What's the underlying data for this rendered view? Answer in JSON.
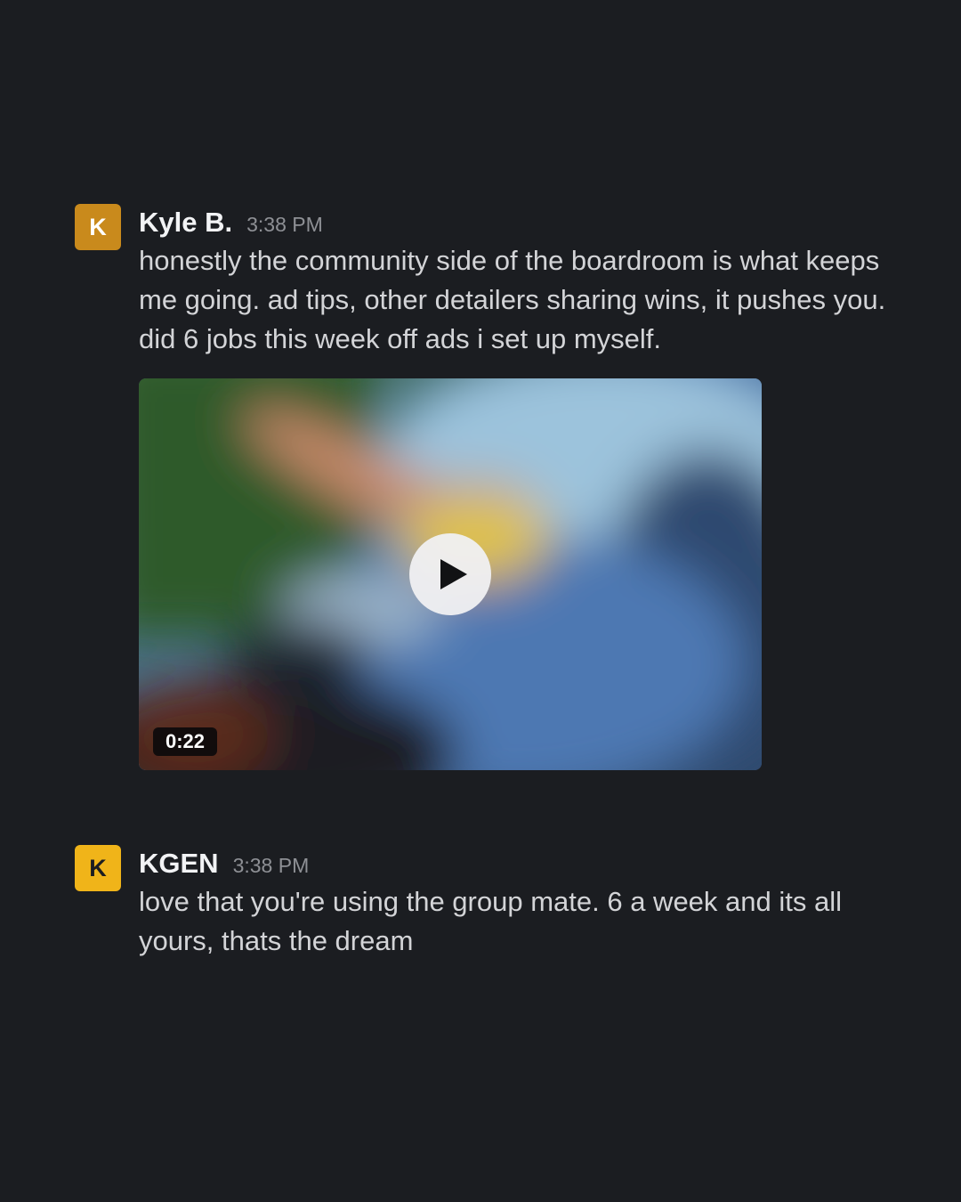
{
  "messages": [
    {
      "avatar_letter": "K",
      "avatar_color": "#c98a1c",
      "author": "Kyle B.",
      "time": "3:38 PM",
      "text": "honestly the community side of the boardroom is what keeps me going. ad tips, other detailers sharing wins, it pushes you. did 6 jobs this week off ads i set up myself.",
      "attachment": {
        "type": "video",
        "duration": "0:22",
        "play_icon": "play-icon"
      }
    },
    {
      "avatar_letter": "K",
      "avatar_color": "#f0b419",
      "author": "KGEN",
      "time": "3:38 PM",
      "text": "love that you're using the group mate. 6 a week and its all yours, thats the dream"
    }
  ],
  "colors": {
    "background": "#1b1d21",
    "author_text": "#f2f3f5",
    "timestamp_text": "#8e9095",
    "body_text": "#d3d4d7"
  }
}
